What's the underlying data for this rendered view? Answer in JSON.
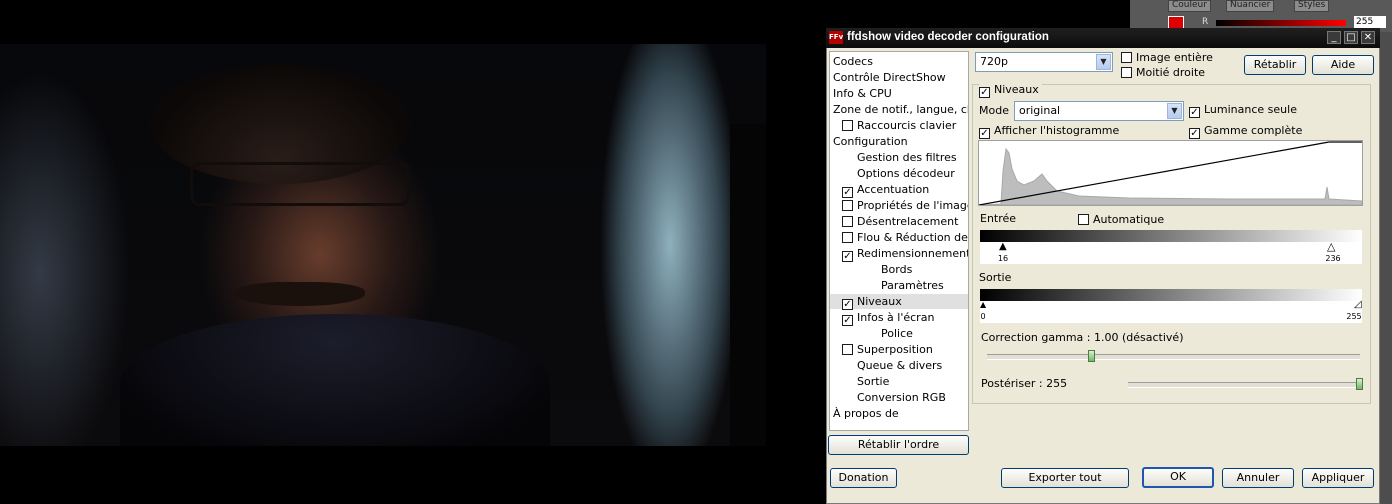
{
  "ps": {
    "tabs": [
      "Couleur",
      "Nuancier",
      "Styles"
    ],
    "value": "255",
    "channel": "R"
  },
  "dialog": {
    "title": "ffdshow video decoder configuration",
    "app_icon": "ffdshow-icon",
    "window_buttons": {
      "minimize": "_",
      "maximize": "□",
      "close": "✕"
    },
    "preset": "720p",
    "image_entiere": "Image entière",
    "moitie_droite": "Moitié droite",
    "retablir": "Rétablir",
    "aide": "Aide",
    "tree": [
      {
        "label": "Codecs",
        "checkbox": false,
        "indent": 0
      },
      {
        "label": "Contrôle DirectShow",
        "checkbox": false,
        "indent": 0
      },
      {
        "label": "Info & CPU",
        "checkbox": false,
        "indent": 0
      },
      {
        "label": "Zone de notif., langue, chem",
        "checkbox": false,
        "indent": 0
      },
      {
        "label": "Raccourcis clavier",
        "checkbox": true,
        "checked": false,
        "indent": 1
      },
      {
        "label": "Configuration",
        "checkbox": false,
        "indent": 0
      },
      {
        "label": "Gestion des filtres",
        "checkbox": false,
        "indent": 2
      },
      {
        "label": "Options décodeur",
        "checkbox": false,
        "indent": 2
      },
      {
        "label": "Accentuation",
        "checkbox": true,
        "checked": true,
        "indent": 1
      },
      {
        "label": "Propriétés de l'image",
        "checkbox": true,
        "checked": false,
        "indent": 1
      },
      {
        "label": "Désentrelacement",
        "checkbox": true,
        "checked": false,
        "indent": 1
      },
      {
        "label": "Flou & Réduction de bru",
        "checkbox": true,
        "checked": false,
        "indent": 1
      },
      {
        "label": "Redimensionnement & F",
        "checkbox": true,
        "checked": true,
        "indent": 1
      },
      {
        "label": "Bords",
        "checkbox": false,
        "indent": 3
      },
      {
        "label": "Paramètres",
        "checkbox": false,
        "indent": 3
      },
      {
        "label": "Niveaux",
        "checkbox": true,
        "checked": true,
        "indent": 1,
        "selected": true
      },
      {
        "label": "Infos à l'écran",
        "checkbox": true,
        "checked": true,
        "indent": 1
      },
      {
        "label": "Police",
        "checkbox": false,
        "indent": 3
      },
      {
        "label": "Superposition",
        "checkbox": true,
        "checked": false,
        "indent": 1
      },
      {
        "label": "Queue & divers",
        "checkbox": false,
        "indent": 2
      },
      {
        "label": "Sortie",
        "checkbox": false,
        "indent": 2
      },
      {
        "label": "Conversion RGB",
        "checkbox": false,
        "indent": 2
      },
      {
        "label": "À propos de",
        "checkbox": false,
        "indent": 0
      }
    ],
    "retablir_ordre": "Rétablir l'ordre",
    "levels": {
      "niveaux": "Niveaux",
      "mode_label": "Mode",
      "mode_value": "original",
      "luminance_seule": "Luminance seule",
      "afficher_histogramme": "Afficher l'histogramme",
      "gamme_complete": "Gamme complète",
      "entree": "Entrée",
      "automatique": "Automatique",
      "input_low": "16",
      "input_high": "236",
      "sortie": "Sortie",
      "output_low": "0",
      "output_high": "255",
      "gamma_label": "Correction gamma : 1.00 (désactivé)",
      "gamma_fraction": 0.28,
      "posterize_label": "Postériser : 255",
      "posterize_fraction": 1.0
    },
    "footer": {
      "donation": "Donation",
      "exporter": "Exporter tout",
      "ok": "OK",
      "annuler": "Annuler",
      "appliquer": "Appliquer"
    }
  }
}
